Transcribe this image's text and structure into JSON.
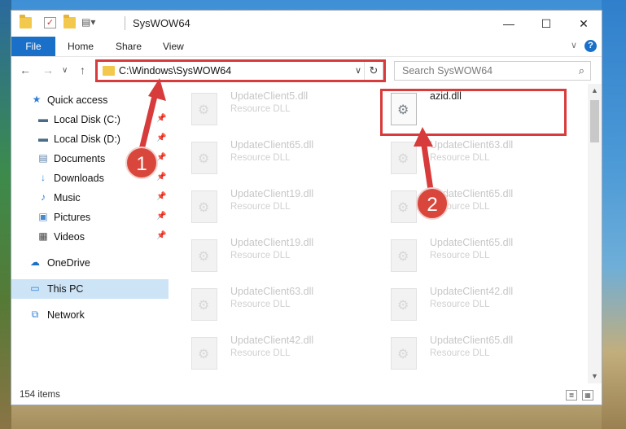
{
  "window": {
    "title": "SysWOW64",
    "controls": {
      "minimize": "—",
      "maximize": "☐",
      "close": "✕"
    }
  },
  "ribbon": {
    "tabs": [
      "File",
      "Home",
      "Share",
      "View"
    ],
    "collapse_glyph": "∨",
    "help_glyph": "?"
  },
  "navigation": {
    "back": "←",
    "forward": "→",
    "recent": "∨",
    "up": "↑",
    "address": "C:\\Windows\\SysWOW64",
    "address_dropdown": "∨",
    "refresh": "↻",
    "search_placeholder": "Search SysWOW64",
    "search_icon": "⌕"
  },
  "sidebar": {
    "items": [
      {
        "label": "Quick access",
        "icon": "star-icon",
        "glyph": "★",
        "color": "#2f7fd8",
        "pinned": false
      },
      {
        "label": "Local Disk (C:)",
        "icon": "drive-icon",
        "glyph": "▬",
        "color": "#4a6b85",
        "pinned": true
      },
      {
        "label": "Local Disk (D:)",
        "icon": "drive-icon",
        "glyph": "▬",
        "color": "#4a6b85",
        "pinned": true
      },
      {
        "label": "Documents",
        "icon": "documents-icon",
        "glyph": "▤",
        "color": "#5a7fa6",
        "pinned": true
      },
      {
        "label": "Downloads",
        "icon": "download-icon",
        "glyph": "↓",
        "color": "#2f7fd8",
        "pinned": true
      },
      {
        "label": "Music",
        "icon": "music-icon",
        "glyph": "♪",
        "color": "#2f7fd8",
        "pinned": true
      },
      {
        "label": "Pictures",
        "icon": "pictures-icon",
        "glyph": "▣",
        "color": "#4a88c8",
        "pinned": true
      },
      {
        "label": "Videos",
        "icon": "videos-icon",
        "glyph": "▦",
        "color": "#444444",
        "pinned": true
      },
      {
        "label": "OneDrive",
        "icon": "cloud-icon",
        "glyph": "☁",
        "color": "#1a70c8",
        "pinned": false
      },
      {
        "label": "This PC",
        "icon": "computer-icon",
        "glyph": "▭",
        "color": "#2f7fd8",
        "pinned": false,
        "selected": true
      },
      {
        "label": "Network",
        "icon": "network-icon",
        "glyph": "⧉",
        "color": "#2f7fd8",
        "pinned": false
      }
    ]
  },
  "files": [
    {
      "name": "UpdateClient5.dll",
      "desc": "Resource DLL",
      "highlighted": false
    },
    {
      "name": "azid.dll",
      "desc": "",
      "highlighted": true
    },
    {
      "name": "UpdateClient65.dll",
      "desc": "Resource DLL",
      "highlighted": false
    },
    {
      "name": "UpdateClient63.dll",
      "desc": "Resource DLL",
      "highlighted": false
    },
    {
      "name": "UpdateClient19.dll",
      "desc": "Resource DLL",
      "highlighted": false
    },
    {
      "name": "UpdateClient65.dll",
      "desc": "Resource DLL",
      "highlighted": false
    },
    {
      "name": "UpdateClient19.dll",
      "desc": "Resource DLL",
      "highlighted": false
    },
    {
      "name": "UpdateClient65.dll",
      "desc": "Resource DLL",
      "highlighted": false
    },
    {
      "name": "UpdateClient63.dll",
      "desc": "Resource DLL",
      "highlighted": false
    },
    {
      "name": "UpdateClient42.dll",
      "desc": "Resource DLL",
      "highlighted": false
    },
    {
      "name": "UpdateClient42.dll",
      "desc": "Resource DLL",
      "highlighted": false
    },
    {
      "name": "UpdateClient65.dll",
      "desc": "Resource DLL",
      "highlighted": false
    }
  ],
  "status": {
    "item_count": "154 items",
    "details_view_glyph": "≣",
    "icons_view_glyph": "▦"
  },
  "annotations": {
    "callout_1": "1",
    "callout_2": "2",
    "color": "#d83b3b"
  },
  "scroll": {
    "up": "▲",
    "down": "▼"
  }
}
